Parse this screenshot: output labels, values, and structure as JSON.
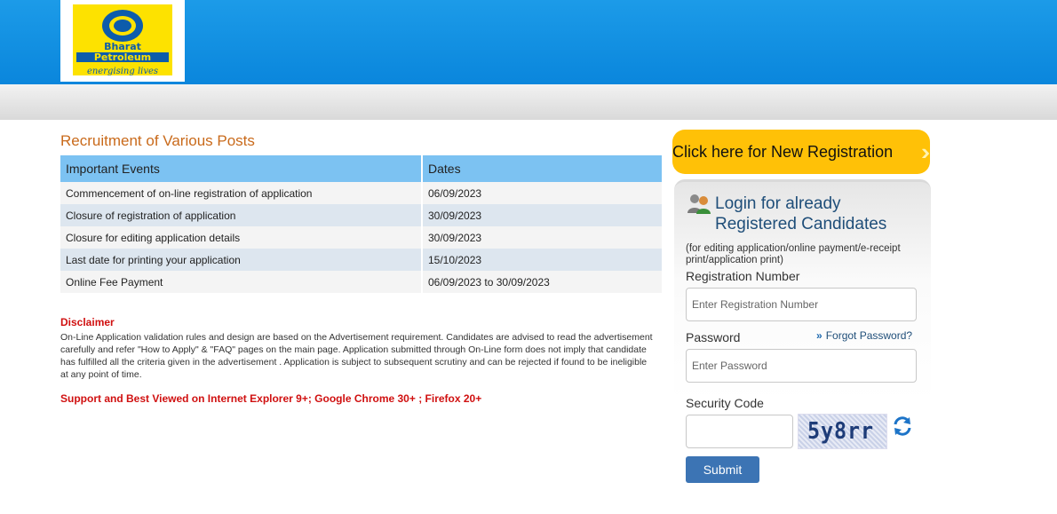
{
  "header": {
    "logo_line1": "Bharat",
    "logo_line2": "Petroleum",
    "logo_tagline": "energising lives"
  },
  "main": {
    "title": "Recruitment of Various Posts",
    "table": {
      "headers": [
        "Important Events",
        "Dates"
      ],
      "rows": [
        [
          "Commencement of on-line registration of application",
          "06/09/2023"
        ],
        [
          "Closure of registration of application",
          "30/09/2023"
        ],
        [
          "Closure for editing application details",
          "30/09/2023"
        ],
        [
          "Last date for printing your application",
          "15/10/2023"
        ],
        [
          "Online Fee Payment",
          "06/09/2023 to 30/09/2023"
        ]
      ]
    },
    "disclaimer_title": "Disclaimer",
    "disclaimer_text": "On-Line Application validation rules and design are based on the Advertisement requirement. Candidates are advised to read the advertisement carefully and refer \"How to Apply\" & \"FAQ\" pages on the main page. Application submitted through On-Line form does not imply that candidate has fulfilled all the criteria given in the advertisement . Application is subject to subsequent scrutiny and can be rejected if found to be ineligible at any point of time.",
    "support_text": "Support and Best Viewed on Internet Explorer 9+; Google Chrome 30+ ; Firefox 20+"
  },
  "sidebar": {
    "register_button": "Click here for New Registration",
    "login_title_line1": "Login for already",
    "login_title_line2": "Registered Candidates",
    "login_note": "(for editing application/online payment/e-receipt print/application print)",
    "reg_number_label": "Registration Number",
    "reg_number_placeholder": "Enter Registration Number",
    "reg_number_value": "",
    "password_label": "Password",
    "password_placeholder": "Enter Password",
    "password_value": "",
    "forgot_password": "Forgot Password?",
    "security_label": "Security Code",
    "security_value": "",
    "captcha_text": "5y8rr",
    "submit_label": "Submit"
  },
  "colors": {
    "header_blue": "#0a86dc",
    "title_orange": "#c96a1b",
    "table_header": "#7cc2f2",
    "register_yellow": "#ffc107",
    "disclaimer_red": "#d01010",
    "submit_blue": "#3c74b4"
  }
}
